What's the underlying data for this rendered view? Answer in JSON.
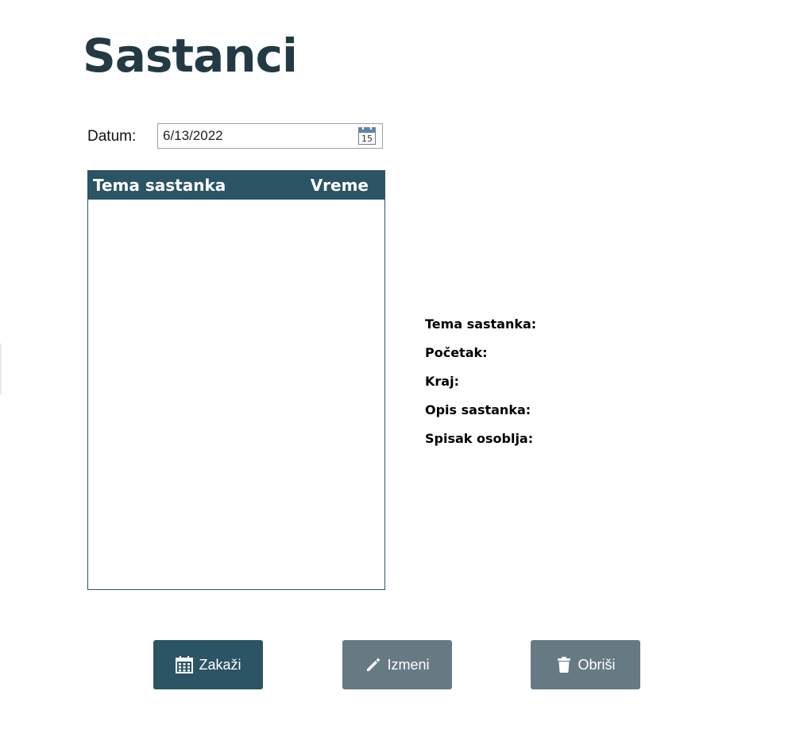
{
  "page": {
    "title": "Sastanci"
  },
  "filter": {
    "date_label": "Datum:",
    "date_value": "6/13/2022",
    "calendar_day": "15"
  },
  "meetings_list": {
    "columns": [
      "Tema sastanka",
      "Vreme"
    ],
    "rows": []
  },
  "details": {
    "topic_label": "Tema sastanka:",
    "start_label": "Početak:",
    "end_label": "Kraj:",
    "description_label": "Opis sastanka:",
    "staff_label": "Spisak osoblja:"
  },
  "actions": {
    "schedule_label": "Zakaži",
    "edit_label": "Izmeni",
    "delete_label": "Obriši"
  },
  "colors": {
    "primary": "#2b5464",
    "secondary": "#667a83",
    "title": "#233a45"
  },
  "icons": {
    "calendar": "calendar-icon",
    "schedule": "calendar-grid-icon",
    "edit": "pencil-icon",
    "delete": "trash-icon"
  }
}
